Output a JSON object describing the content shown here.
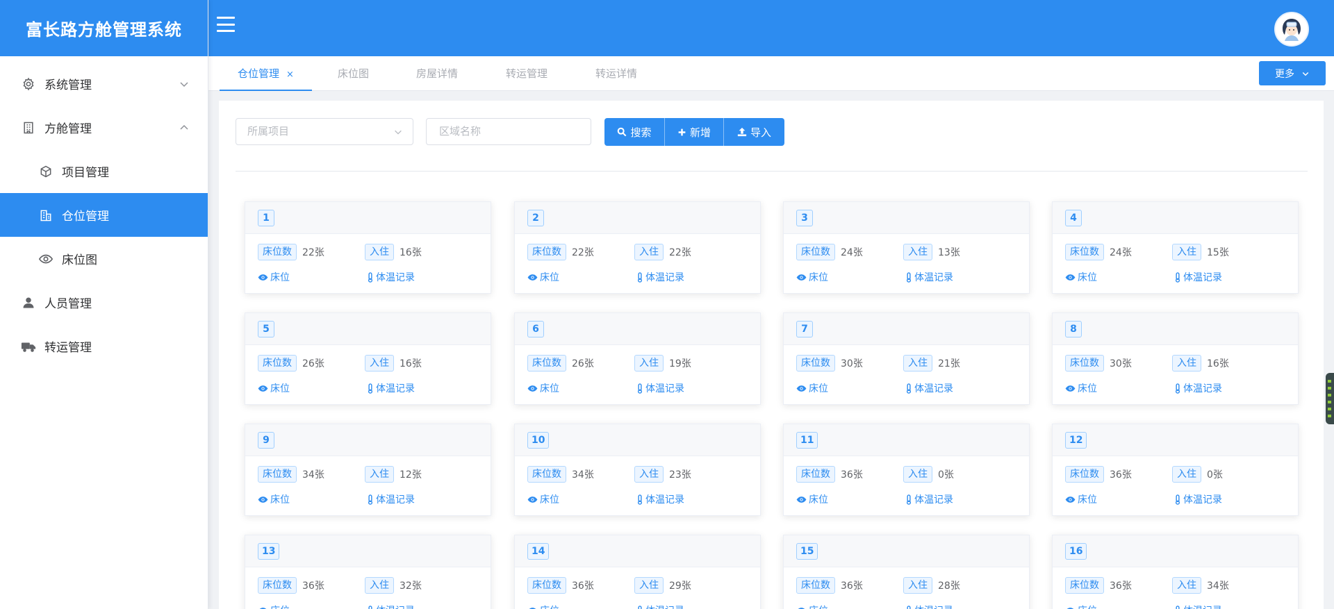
{
  "app": {
    "title": "富长路方舱管理系统"
  },
  "sidebar": {
    "items": [
      {
        "label": "系统管理",
        "icon": "gear-icon",
        "expanded": false
      },
      {
        "label": "方舱管理",
        "icon": "building-icon",
        "expanded": true
      },
      {
        "label": "项目管理",
        "icon": "cube-icon",
        "sub": true
      },
      {
        "label": "仓位管理",
        "icon": "office-icon",
        "sub": true,
        "active": true
      },
      {
        "label": "床位图",
        "icon": "eye-icon",
        "sub": true
      },
      {
        "label": "人员管理",
        "icon": "user-icon"
      },
      {
        "label": "转运管理",
        "icon": "truck-icon"
      }
    ]
  },
  "tabs": [
    {
      "label": "仓位管理",
      "active": true,
      "close": "×"
    },
    {
      "label": "床位图"
    },
    {
      "label": "房屋详情"
    },
    {
      "label": "转运管理"
    },
    {
      "label": "转运详情"
    }
  ],
  "more_button": "更多",
  "filters": {
    "project_placeholder": "所属项目",
    "area_placeholder": "区域名称"
  },
  "buttons": {
    "search": "搜索",
    "add": "新增",
    "import": "导入"
  },
  "card_labels": {
    "beds": "床位数",
    "occupied": "入住",
    "bed_link": "床位",
    "temp_link": "体温记录"
  },
  "cards": [
    {
      "id": "1",
      "beds": "22张",
      "occupied": "16张"
    },
    {
      "id": "2",
      "beds": "22张",
      "occupied": "22张"
    },
    {
      "id": "3",
      "beds": "24张",
      "occupied": "13张"
    },
    {
      "id": "4",
      "beds": "24张",
      "occupied": "15张"
    },
    {
      "id": "5",
      "beds": "26张",
      "occupied": "16张"
    },
    {
      "id": "6",
      "beds": "26张",
      "occupied": "19张"
    },
    {
      "id": "7",
      "beds": "30张",
      "occupied": "21张"
    },
    {
      "id": "8",
      "beds": "30张",
      "occupied": "16张"
    },
    {
      "id": "9",
      "beds": "34张",
      "occupied": "12张"
    },
    {
      "id": "10",
      "beds": "34张",
      "occupied": "23张"
    },
    {
      "id": "11",
      "beds": "36张",
      "occupied": "0张"
    },
    {
      "id": "12",
      "beds": "36张",
      "occupied": "0张"
    },
    {
      "id": "13",
      "beds": "36张",
      "occupied": "32张"
    },
    {
      "id": "14",
      "beds": "36张",
      "occupied": "29张"
    },
    {
      "id": "15",
      "beds": "36张",
      "occupied": "28张"
    },
    {
      "id": "16",
      "beds": "36张",
      "occupied": "34张"
    }
  ],
  "colors": {
    "primary": "#2d8cf0",
    "tag_bg": "#ecf5ff",
    "tag_border": "#b3d8ff"
  }
}
